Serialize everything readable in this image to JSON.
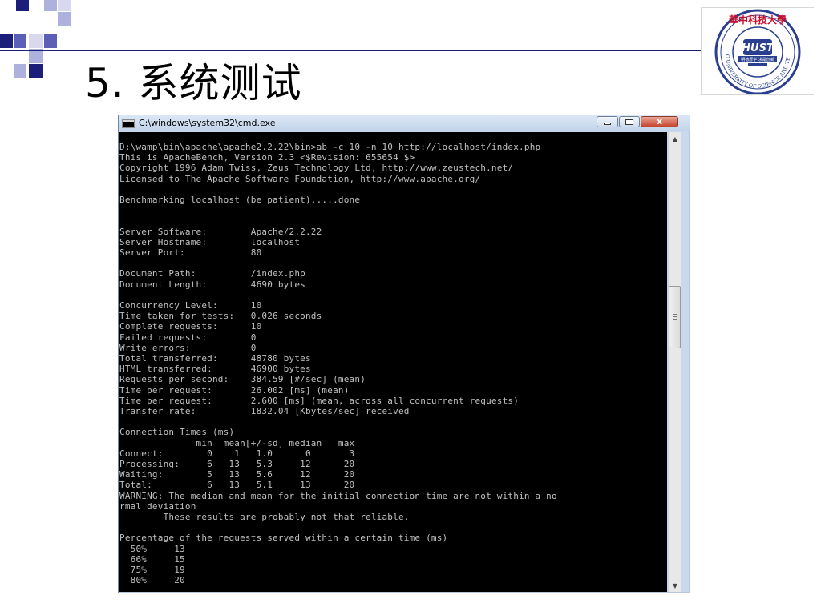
{
  "slide": {
    "title": "5. 系统测试"
  },
  "logo": {
    "text_top": "華中科技大學",
    "text_ring": "HUAZHONG UNIVERSITY OF SCIENCE AND TECHNOLOGY",
    "text_motto": "明德厚学 求是创新",
    "colors": {
      "ring": "#2a3f8f",
      "text": "#c8102e"
    }
  },
  "window": {
    "title": "C:\\windows\\system32\\cmd.exe",
    "minimize_label": "",
    "maximize_label": "",
    "close_label": "x"
  },
  "console": {
    "lines": [
      "D:\\wamp\\bin\\apache\\apache2.2.22\\bin>ab -c 10 -n 10 http://localhost/index.php",
      "This is ApacheBench, Version 2.3 <$Revision: 655654 $>",
      "Copyright 1996 Adam Twiss, Zeus Technology Ltd, http://www.zeustech.net/",
      "Licensed to The Apache Software Foundation, http://www.apache.org/",
      "",
      "Benchmarking localhost (be patient).....done",
      "",
      "",
      "Server Software:        Apache/2.2.22",
      "Server Hostname:        localhost",
      "Server Port:            80",
      "",
      "Document Path:          /index.php",
      "Document Length:        4690 bytes",
      "",
      "Concurrency Level:      10",
      "Time taken for tests:   0.026 seconds",
      "Complete requests:      10",
      "Failed requests:        0",
      "Write errors:           0",
      "Total transferred:      48780 bytes",
      "HTML transferred:       46900 bytes",
      "Requests per second:    384.59 [#/sec] (mean)",
      "Time per request:       26.002 [ms] (mean)",
      "Time per request:       2.600 [ms] (mean, across all concurrent requests)",
      "Transfer rate:          1832.04 [Kbytes/sec] received",
      "",
      "Connection Times (ms)",
      "              min  mean[+/-sd] median   max",
      "Connect:        0    1   1.0      0       3",
      "Processing:     6   13   5.3     12      20",
      "Waiting:        5   13   5.6     12      20",
      "Total:          6   13   5.1     13      20",
      "WARNING: The median and mean for the initial connection time are not within a no",
      "rmal deviation",
      "        These results are probably not that reliable.",
      "",
      "Percentage of the requests served within a certain time (ms)",
      "  50%     13",
      "  66%     15",
      "  75%     19",
      "  80%     20"
    ]
  },
  "scrollbar": {
    "up_icon": "arrow-up-icon",
    "down_icon": "arrow-down-icon",
    "grip_icon": "grip-icon",
    "position_fraction": 0.38
  },
  "colors": {
    "console_bg": "#000000",
    "console_text": "#c0c0c0",
    "accent_dark": "#1c1f7a",
    "accent_mid": "#5b5fb6",
    "accent_light": "#aeb0dd"
  }
}
